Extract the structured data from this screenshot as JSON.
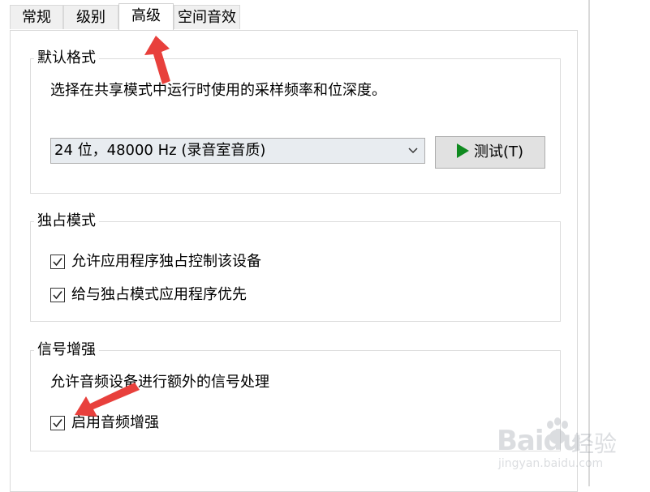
{
  "tabs": [
    {
      "label": "常规",
      "active": false
    },
    {
      "label": "级别",
      "active": false
    },
    {
      "label": "高级",
      "active": true
    },
    {
      "label": "空间音效",
      "active": false
    }
  ],
  "default_format": {
    "title": "默认格式",
    "description": "选择在共享模式中运行时使用的采样频率和位深度。",
    "selected_format": "24 位，48000 Hz (录音室音质)",
    "test_button": "测试(T)"
  },
  "exclusive_mode": {
    "title": "独占模式",
    "options": [
      {
        "label": "允许应用程序独占控制该设备",
        "checked": true
      },
      {
        "label": "给与独占模式应用程序优先",
        "checked": true
      }
    ]
  },
  "enhancements": {
    "title": "信号增强",
    "description": "允许音频设备进行额外的信号处理",
    "option": {
      "label": "启用音频增强",
      "checked": true
    }
  },
  "annotations": {
    "arrow_color": "#e8403c"
  },
  "watermark": {
    "logo": "Baidu",
    "text": "经验",
    "url": "jingyan.baidu.com"
  },
  "colors": {
    "play_icon": "#0f8a1f",
    "select_bg": "#e8ecf0",
    "button_bg": "#e1e1e1"
  }
}
